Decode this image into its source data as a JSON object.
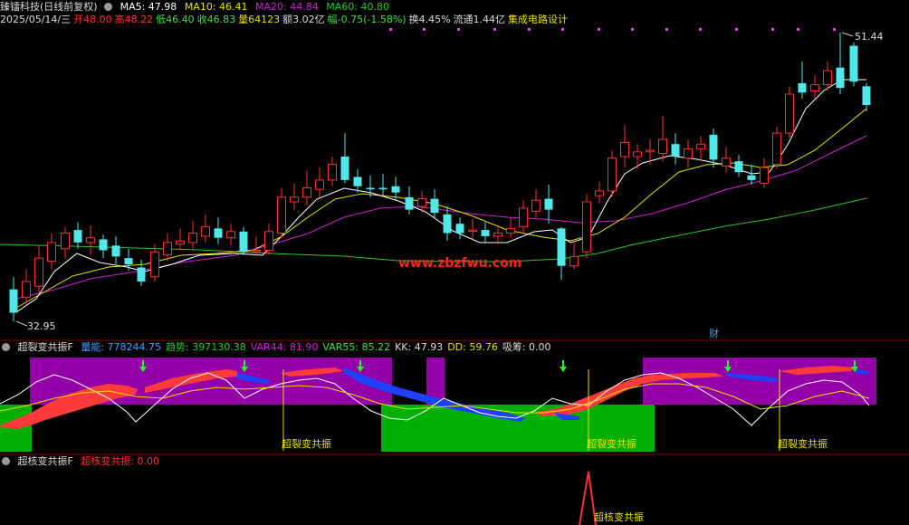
{
  "main": {
    "title": "臻镭科技(日线前复权)",
    "ma": [
      {
        "label": "MA5: 47.98",
        "color": "#ffffff"
      },
      {
        "label": "MA10: 46.41",
        "color": "#e8e000"
      },
      {
        "label": "MA20: 44.84",
        "color": "#d020d0"
      },
      {
        "label": "MA60: 40.80",
        "color": "#28c828"
      }
    ],
    "info": [
      {
        "text": "2025/05/14/三",
        "color": "#dddddd"
      },
      {
        "text": "开48.00",
        "color": "#ff3030"
      },
      {
        "text": "高48.22",
        "color": "#ff3030"
      },
      {
        "text": "低46.40",
        "color": "#40e040"
      },
      {
        "text": "收46.83",
        "color": "#40e040"
      },
      {
        "text": "量64123",
        "color": "#e8e000"
      },
      {
        "text": "额3.02亿",
        "color": "#dddddd"
      },
      {
        "text": "幅-0.75(-1.58%)",
        "color": "#40e040"
      },
      {
        "text": "换4.45%",
        "color": "#dddddd"
      },
      {
        "text": "流通1.44亿",
        "color": "#dddddd"
      },
      {
        "text": "集成电路设计",
        "color": "#e8e000"
      }
    ],
    "high_label": "51.44",
    "low_label": "32.95",
    "finance_tag": "财",
    "watermark": "www.zbzfwu.com"
  },
  "panel2": {
    "title": "超裂变共振F",
    "items": [
      {
        "text": "量能: 778244.75",
        "color": "#40a0ff"
      },
      {
        "text": "趋势: 397130.38",
        "color": "#28c828"
      },
      {
        "text": "VAR44: 81.90",
        "color": "#d020d0"
      },
      {
        "text": "VAR55: 85.22",
        "color": "#40e040"
      },
      {
        "text": "KK: 47.93",
        "color": "#dddddd"
      },
      {
        "text": "DD: 59.76",
        "color": "#e8e000"
      },
      {
        "text": "吸筹: 0.00",
        "color": "#dddddd"
      }
    ],
    "signal_label": "超裂变共振"
  },
  "panel3": {
    "title": "超核变共振F",
    "value": "超核变共振: 0.00",
    "signal_label": "超核变共振"
  },
  "colors": {
    "up": "#ff3030",
    "down": "#50e8e8",
    "grid": "#8b0000",
    "purple": "#9400a8",
    "green": "#00b000"
  }
}
